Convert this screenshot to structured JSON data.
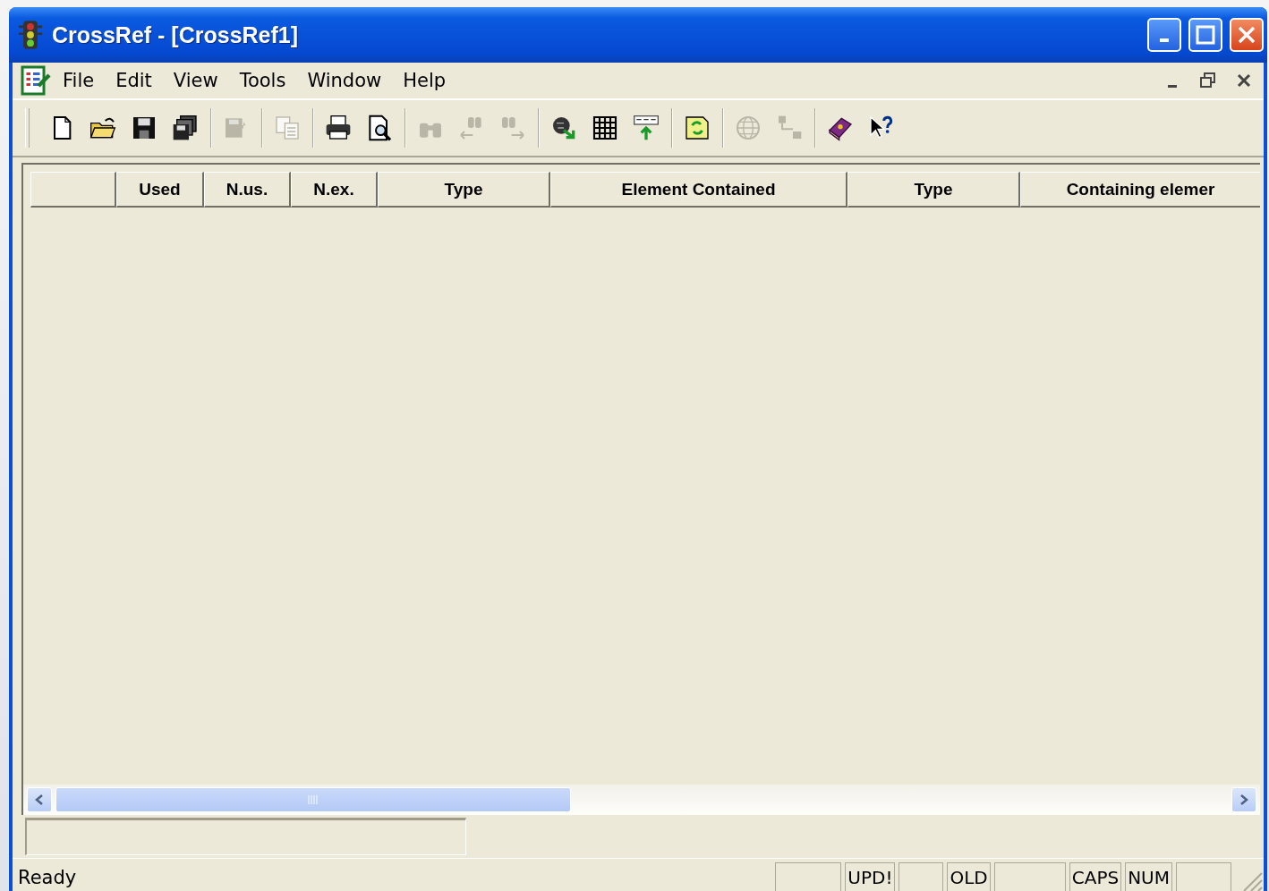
{
  "window": {
    "title": "CrossRef - [CrossRef1]"
  },
  "menu": [
    "File",
    "Edit",
    "View",
    "Tools",
    "Window",
    "Help"
  ],
  "toolbar": [
    [
      {
        "disabled": false
      },
      {
        "disabled": false
      },
      {
        "disabled": false
      },
      {
        "disabled": false
      }
    ],
    [
      {
        "disabled": true
      }
    ],
    [
      {
        "disabled": true
      }
    ],
    [
      {
        "disabled": false
      },
      {
        "disabled": false
      }
    ],
    [
      {
        "disabled": true
      },
      {
        "disabled": true
      },
      {
        "disabled": true
      }
    ],
    [
      {
        "disabled": false
      },
      {
        "disabled": false
      },
      {
        "disabled": false
      }
    ],
    [
      {
        "disabled": false
      }
    ],
    [
      {
        "disabled": true
      },
      {
        "disabled": true
      }
    ],
    [
      {
        "disabled": false
      },
      {
        "disabled": false
      }
    ]
  ],
  "table": {
    "columns": [
      "Used",
      "N.us.",
      "N.ex.",
      "Type",
      "Element Contained",
      "Type",
      "Containing elemer"
    ]
  },
  "status_bar": {
    "text": "Ready",
    "indicators": [
      "UPD!",
      "OLD",
      "CAPS",
      "NUM"
    ]
  }
}
